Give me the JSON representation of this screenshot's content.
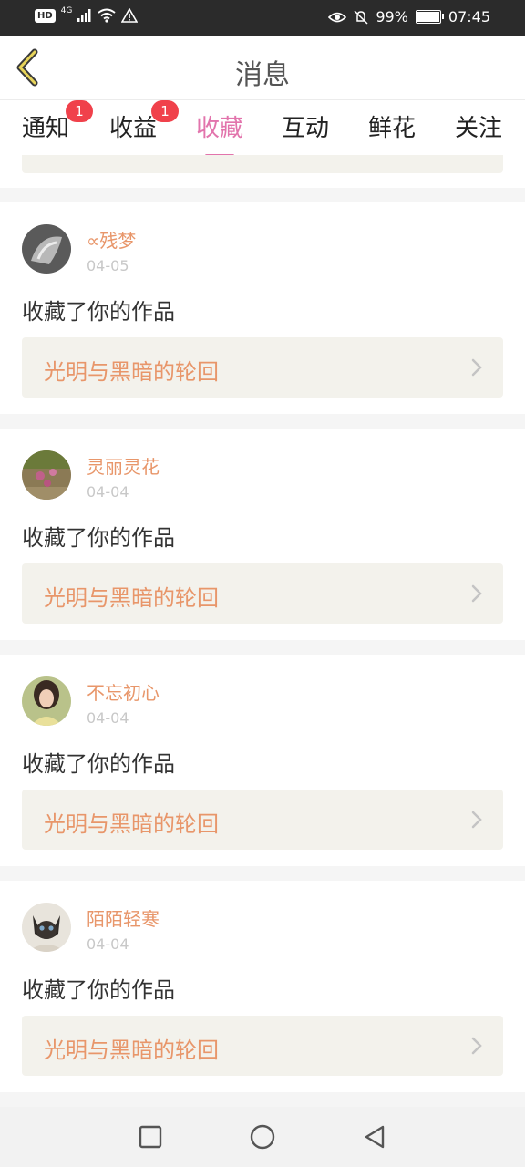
{
  "status_bar": {
    "hd": "HD",
    "network": "4G",
    "battery_percent": "99%",
    "battery_level": 0.99,
    "time": "07:45"
  },
  "header": {
    "title": "消息"
  },
  "tabs": [
    {
      "label": "通知",
      "badge": "1",
      "active": false
    },
    {
      "label": "收益",
      "badge": "1",
      "active": false
    },
    {
      "label": "收藏",
      "badge": "",
      "active": true
    },
    {
      "label": "互动",
      "badge": "",
      "active": false
    },
    {
      "label": "鲜花",
      "badge": "",
      "active": false
    },
    {
      "label": "关注",
      "badge": "",
      "active": false
    }
  ],
  "items": [
    {
      "user": "∝残梦",
      "date": "04-05",
      "action": "收藏了你的作品",
      "work": "光明与黑暗的轮回",
      "avatar_icon": "gray-photo-avatar"
    },
    {
      "user": "灵丽灵花",
      "date": "04-04",
      "action": "收藏了你的作品",
      "work": "光明与黑暗的轮回",
      "avatar_icon": "flower-photo-avatar"
    },
    {
      "user": "不忘初心",
      "date": "04-04",
      "action": "收藏了你的作品",
      "work": "光明与黑暗的轮回",
      "avatar_icon": "portrait-photo-avatar"
    },
    {
      "user": "陌陌轻寒",
      "date": "04-04",
      "action": "收藏了你的作品",
      "work": "光明与黑暗的轮回",
      "avatar_icon": "cat-photo-avatar"
    }
  ],
  "colors": {
    "accent": "#e274ac",
    "username": "#e8966a",
    "badge": "#f0414b",
    "card_bg": "#f3f2ec"
  }
}
